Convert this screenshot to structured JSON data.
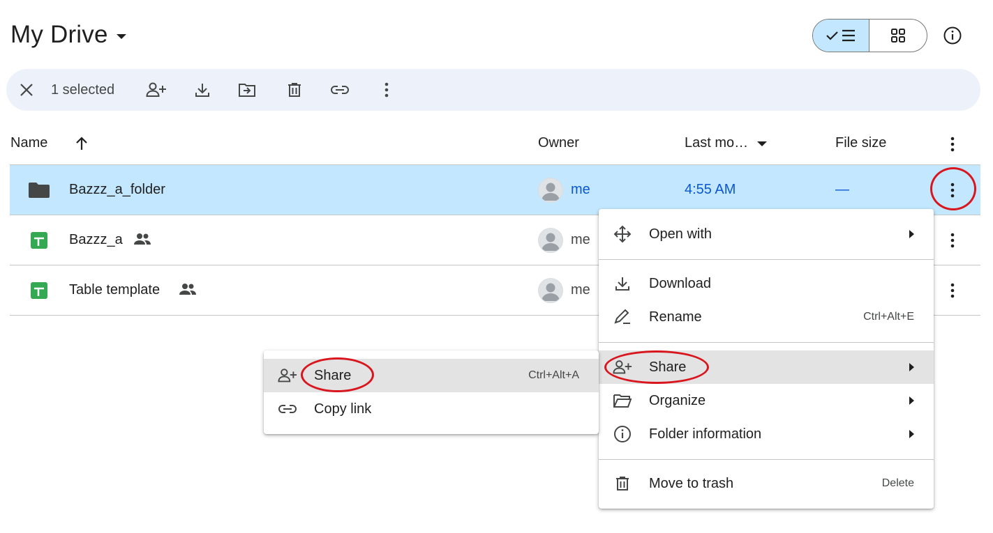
{
  "header": {
    "title": "My Drive",
    "view_list_icon": "check-list-icon",
    "view_grid_icon": "grid-icon",
    "info_icon": "info-icon"
  },
  "selection_bar": {
    "count_label": "1 selected",
    "actions": [
      "close-icon",
      "share-icon",
      "download-icon",
      "move-icon",
      "trash-icon",
      "link-icon",
      "more-vert-icon"
    ]
  },
  "columns": {
    "name": "Name",
    "owner": "Owner",
    "modified": "Last mo…",
    "size": "File size"
  },
  "files": [
    {
      "name": "Bazzz_a_folder",
      "type": "folder",
      "shared": false,
      "owner": "me",
      "modified": "4:55 AM",
      "size": "—",
      "selected": true
    },
    {
      "name": "Bazzz_a",
      "type": "sheet",
      "shared": true,
      "owner": "me",
      "modified": "",
      "size": "",
      "selected": false
    },
    {
      "name": "Table template",
      "type": "sheet",
      "shared": true,
      "owner": "me",
      "modified": "",
      "size": "",
      "selected": false
    }
  ],
  "context_menu": {
    "items": [
      {
        "label": "Open with",
        "icon": "move-arrows-icon",
        "shortcut": "",
        "submenu": true
      },
      {
        "label": "Download",
        "icon": "download-icon",
        "shortcut": "",
        "submenu": false
      },
      {
        "label": "Rename",
        "icon": "pencil-icon",
        "shortcut": "Ctrl+Alt+E",
        "submenu": false
      },
      {
        "label": "Share",
        "icon": "share-icon",
        "shortcut": "",
        "submenu": true
      },
      {
        "label": "Organize",
        "icon": "folder-open-icon",
        "shortcut": "",
        "submenu": true
      },
      {
        "label": "Folder information",
        "icon": "info-icon",
        "shortcut": "",
        "submenu": true
      },
      {
        "label": "Move to trash",
        "icon": "trash-icon",
        "shortcut": "Delete",
        "submenu": false
      }
    ]
  },
  "share_submenu": {
    "items": [
      {
        "label": "Share",
        "icon": "share-icon",
        "shortcut": "Ctrl+Alt+A"
      },
      {
        "label": "Copy link",
        "icon": "link-icon",
        "shortcut": ""
      }
    ]
  },
  "colors": {
    "selected_row": "#c2e7ff",
    "selection_bar": "#edf2fa",
    "menu_highlight": "#e3e3e3",
    "annotation_red": "#d9151d",
    "sheet_green": "#34a853",
    "link_blue": "#0b57d0"
  }
}
